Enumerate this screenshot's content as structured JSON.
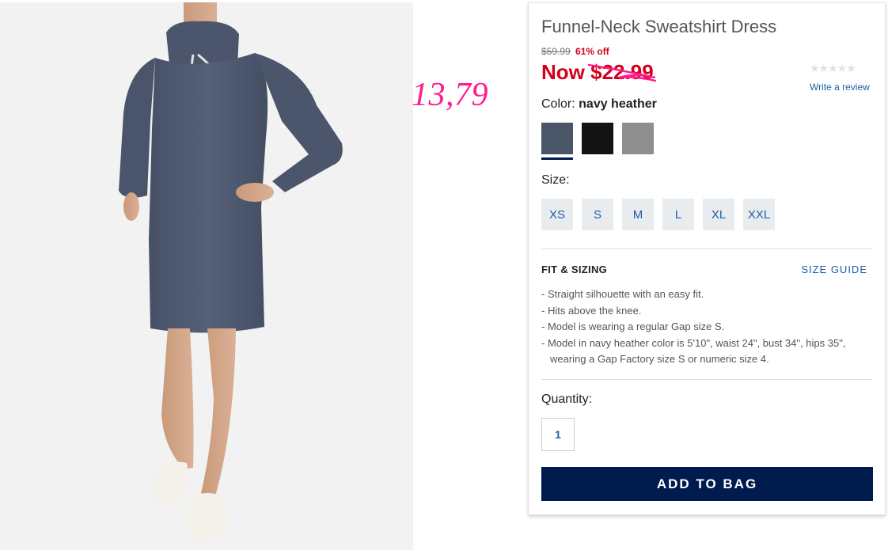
{
  "annotation": {
    "text": "13,79",
    "color": "#ff1c8d"
  },
  "product": {
    "title": "Funnel-Neck Sweatshirt Dress",
    "original_price": "$59.99",
    "discount": "61% off",
    "now_label": "Now",
    "now_price": "$22.99",
    "rating_stars": "★★★★★",
    "review_link": "Write a review",
    "product_image_icon": "model-wearing-dress-photo"
  },
  "color": {
    "label": "Color:",
    "selected": "navy heather",
    "swatches": [
      {
        "name": "navy heather",
        "hex": "#4a5568",
        "selected": true
      },
      {
        "name": "black",
        "hex": "#141414",
        "selected": false
      },
      {
        "name": "gray heather",
        "hex": "#8f8f8f",
        "selected": false
      }
    ]
  },
  "size": {
    "label": "Size:",
    "options": [
      "XS",
      "S",
      "M",
      "L",
      "XL",
      "XXL"
    ]
  },
  "fit": {
    "title": "FIT & SIZING",
    "guide_link": "SIZE GUIDE",
    "bullets": [
      "Straight silhouette with an easy fit.",
      "Hits above the knee.",
      "Model is wearing a regular Gap size S.",
      "Model in navy heather color is 5'10\", waist 24\", bust 34\", hips 35\", wearing a Gap Factory size S or numeric size 4."
    ]
  },
  "quantity": {
    "label": "Quantity:",
    "value": "1"
  },
  "cart": {
    "add_label": "ADD TO BAG"
  },
  "colors": {
    "accent": "#d4001a",
    "link": "#1a5ea6",
    "button": "#001b4d"
  }
}
